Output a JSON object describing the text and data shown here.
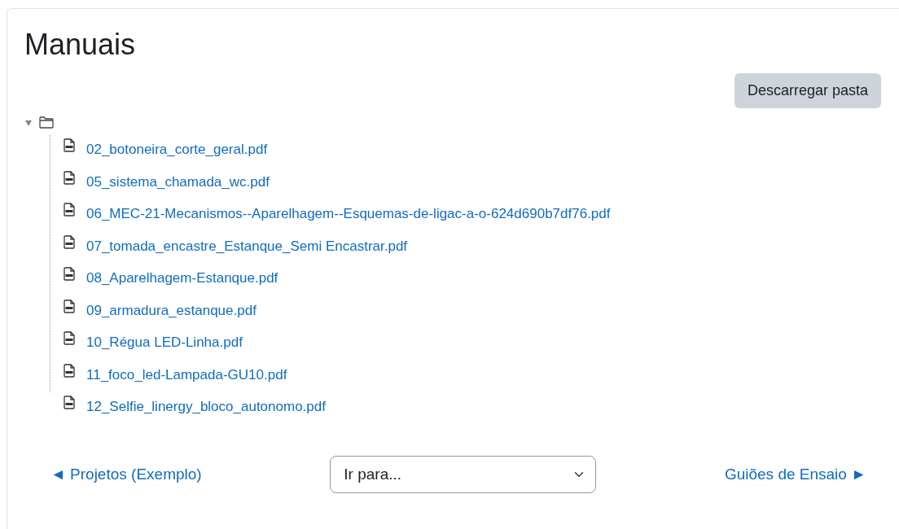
{
  "title": "Manuais",
  "download_button": "Descarregar pasta",
  "folder": {
    "expanded": true,
    "children": [
      {
        "name": "02_botoneira_corte_geral.pdf"
      },
      {
        "name": "05_sistema_chamada_wc.pdf"
      },
      {
        "name": "06_MEC-21-Mecanismos--Aparelhagem--Esquemas-de-ligac-a-o-624d690b7df76.pdf"
      },
      {
        "name": "07_tomada_encastre_Estanque_Semi Encastrar.pdf"
      },
      {
        "name": "08_Aparelhagem-Estanque.pdf"
      },
      {
        "name": "09_armadura_estanque.pdf"
      },
      {
        "name": "10_Régua LED-Linha.pdf"
      },
      {
        "name": "11_foco_led-Lampada-GU10.pdf"
      },
      {
        "name": "12_Selfie_linergy_bloco_autonomo.pdf"
      }
    ]
  },
  "nav": {
    "previous": "◄ Projetos (Exemplo)",
    "jump_placeholder": "Ir para...",
    "next": "Guiões de Ensaio ►"
  }
}
